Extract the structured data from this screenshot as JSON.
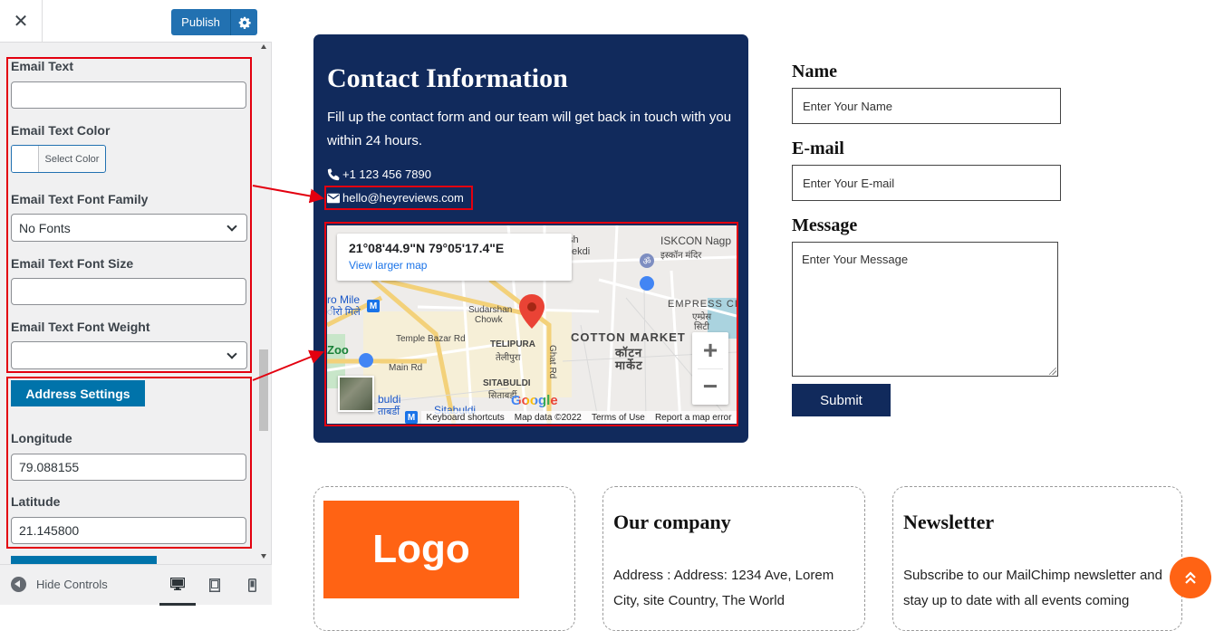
{
  "customizer": {
    "publish_label": "Publish",
    "controls": {
      "email_text_label": "Email Text",
      "email_text_value": "",
      "email_text_color_label": "Email Text Color",
      "select_color_label": "Select Color",
      "email_font_family_label": "Email Text Font Family",
      "email_font_family_value": "No Fonts",
      "email_font_size_label": "Email Text Font Size",
      "email_font_size_value": "",
      "email_font_weight_label": "Email Text Font Weight",
      "email_font_weight_value": "",
      "address_settings_label": "Address Settings",
      "longitude_label": "Longitude",
      "longitude_value": "79.088155",
      "latitude_label": "Latitude",
      "latitude_value": "21.145800"
    },
    "hide_controls_label": "Hide Controls"
  },
  "contact": {
    "title": "Contact Information",
    "description": "Fill up the contact form and our team will get back in touch with you within 24 hours.",
    "phone": "+1 123 456 7890",
    "email": "hello@heyreviews.com"
  },
  "map": {
    "coords": "21°08'44.9\"N 79°05'17.4\"E",
    "view_larger": "View larger map",
    "footer": {
      "shortcuts": "Keyboard shortcuts",
      "data": "Map data ©2022",
      "terms": "Terms of Use",
      "report": "Report a map error"
    },
    "labels": {
      "iskcon": "ISKCON Nagp",
      "iskcon_hi": "इस्कॉन मंदिर",
      "sh": "sh",
      "ekdi": "ekdi",
      "ro_mile": "ro Mile",
      "ro_mile_hi": "ीरो मिले",
      "sudarshan": "Sudarshan",
      "chowk": "Chowk",
      "empress": "EMPRESS CITY",
      "empress_hi1": "एम्प्रेस",
      "empress_hi2": "सिटी",
      "temple_bazar": "Temple Bazar Rd",
      "telipura": "TELIPURA",
      "telipura_hi": "तेलीपुरा",
      "cotton_market": "COTTON MARKET",
      "cotton_hi1": "कॉटन",
      "cotton_hi2": "मार्केट",
      "zoo": "Zoo",
      "main_rd": "Main Rd",
      "ghat_rd": "Ghat Rd",
      "sitabuldi": "SITABULDI",
      "sitabuldi_hi": "सिताबर्डी",
      "buldi": "buldi",
      "tabardi": "ताबर्डी",
      "sitabuldi2": "Sitabuldi",
      "google": "Google"
    }
  },
  "form": {
    "name_label": "Name",
    "name_placeholder": "Enter Your Name",
    "email_label": "E-mail",
    "email_placeholder": "Enter Your E-mail",
    "message_label": "Message",
    "message_placeholder": "Enter Your Message",
    "submit_label": "Submit"
  },
  "footer": {
    "logo_text": "Logo",
    "company_title": "Our company",
    "company_text": "Address : Address: 1234 Ave, Lorem City, site Country, The World",
    "newsletter_title": "Newsletter",
    "newsletter_text": "Subscribe to our MailChimp newsletter and stay up to date with all events coming"
  },
  "colors": {
    "publish": "#2271b1",
    "address_button": "#0073aa",
    "contact_card": "#112a5c",
    "accent_orange": "#ff6314",
    "annotation_red": "#e3000f"
  },
  "icons": [
    "close-icon",
    "gear-icon",
    "phone-icon",
    "envelope-icon",
    "map-pin-icon",
    "zoom-in-icon",
    "zoom-out-icon",
    "desktop-icon",
    "tablet-icon",
    "mobile-icon",
    "hide-controls-icon",
    "chevron-double-up-icon"
  ]
}
